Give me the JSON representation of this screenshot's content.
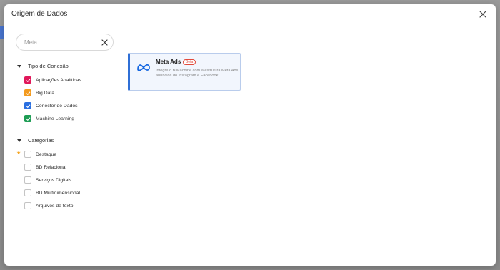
{
  "modal": {
    "title": "Origem de Dados"
  },
  "search": {
    "value": "Meta",
    "placeholder": "Meta"
  },
  "connection_type": {
    "label": "Tipo de Conexão",
    "items": [
      {
        "label": "Aplicações Analíticas",
        "color": "#e0185a",
        "checked": true
      },
      {
        "label": "Big Data",
        "color": "#f39a1e",
        "checked": true
      },
      {
        "label": "Conector de Dados",
        "color": "#2a6fe0",
        "checked": true
      },
      {
        "label": "Machine Learning",
        "color": "#1f9d55",
        "checked": true
      }
    ]
  },
  "categories": {
    "label": "Categorias",
    "items": [
      {
        "label": "Destaque",
        "starred": true,
        "checked": false
      },
      {
        "label": "BD Relacional",
        "checked": false
      },
      {
        "label": "Serviços Digitais",
        "checked": false
      },
      {
        "label": "BD Multidimensional",
        "checked": false
      },
      {
        "label": "Arquivos de texto",
        "checked": false
      }
    ]
  },
  "results": [
    {
      "title": "Meta Ads",
      "badge": "Beta",
      "description": "Integre o BIMachine com a estrutura Meta Ads, anuncios do Instagram e Facebook",
      "icon": "meta-logo-icon"
    }
  ]
}
